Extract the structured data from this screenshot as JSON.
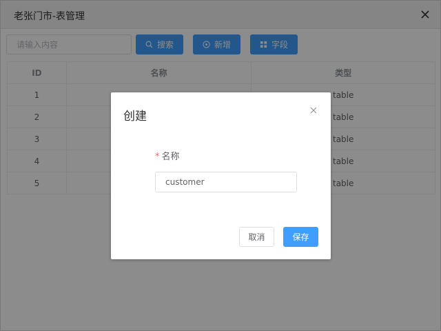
{
  "window": {
    "title": "老张门市-表管理"
  },
  "toolbar": {
    "search_placeholder": "请输入内容",
    "search_label": "搜索",
    "add_label": "新增",
    "fields_label": "字段"
  },
  "table": {
    "headers": [
      "ID",
      "名称",
      "类型"
    ],
    "rows": [
      {
        "id": "1",
        "name": "",
        "type": "table"
      },
      {
        "id": "2",
        "name": "",
        "type": "table"
      },
      {
        "id": "3",
        "name": "",
        "type": "table"
      },
      {
        "id": "4",
        "name": "",
        "type": "table"
      },
      {
        "id": "5",
        "name": "",
        "type": "table"
      }
    ]
  },
  "dialog": {
    "title": "创建",
    "required_mark": "*",
    "name_label": "名称",
    "name_value": "customer",
    "cancel_label": "取消",
    "save_label": "保存"
  },
  "colors": {
    "primary": "#409eff",
    "required": "#f56c6c",
    "mask": "rgba(0,0,0,0.45)"
  },
  "icons": {
    "close": "close-icon",
    "search": "search-icon",
    "add": "plus-circle-icon",
    "fields": "grid-icon"
  }
}
